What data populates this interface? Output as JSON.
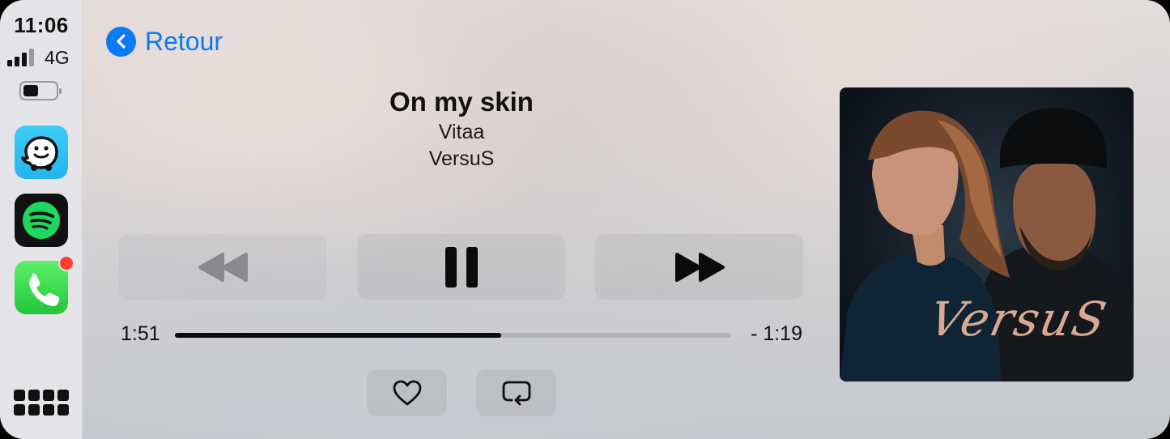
{
  "status": {
    "time": "11:06",
    "network": "4G"
  },
  "sidebar": {
    "apps": [
      {
        "name": "Waze",
        "icon": "waze-icon"
      },
      {
        "name": "Spotify",
        "icon": "spotify-icon"
      },
      {
        "name": "Phone",
        "icon": "phone-icon",
        "badge": true
      }
    ],
    "home_icon": "app-grid-icon"
  },
  "nav": {
    "back_label": "Retour"
  },
  "track": {
    "title": "On my skin",
    "artist": "Vitaa",
    "album": "VersuS"
  },
  "progress": {
    "elapsed": "1:51",
    "remaining": "- 1:19",
    "fraction": 0.587
  },
  "album_art": {
    "text": "VersuS"
  },
  "colors": {
    "accent": "#0a7af5",
    "badge": "#ff3b30",
    "waze": "#33c6f4",
    "spotify_green": "#1ed760",
    "phone_green": "#34d158"
  }
}
